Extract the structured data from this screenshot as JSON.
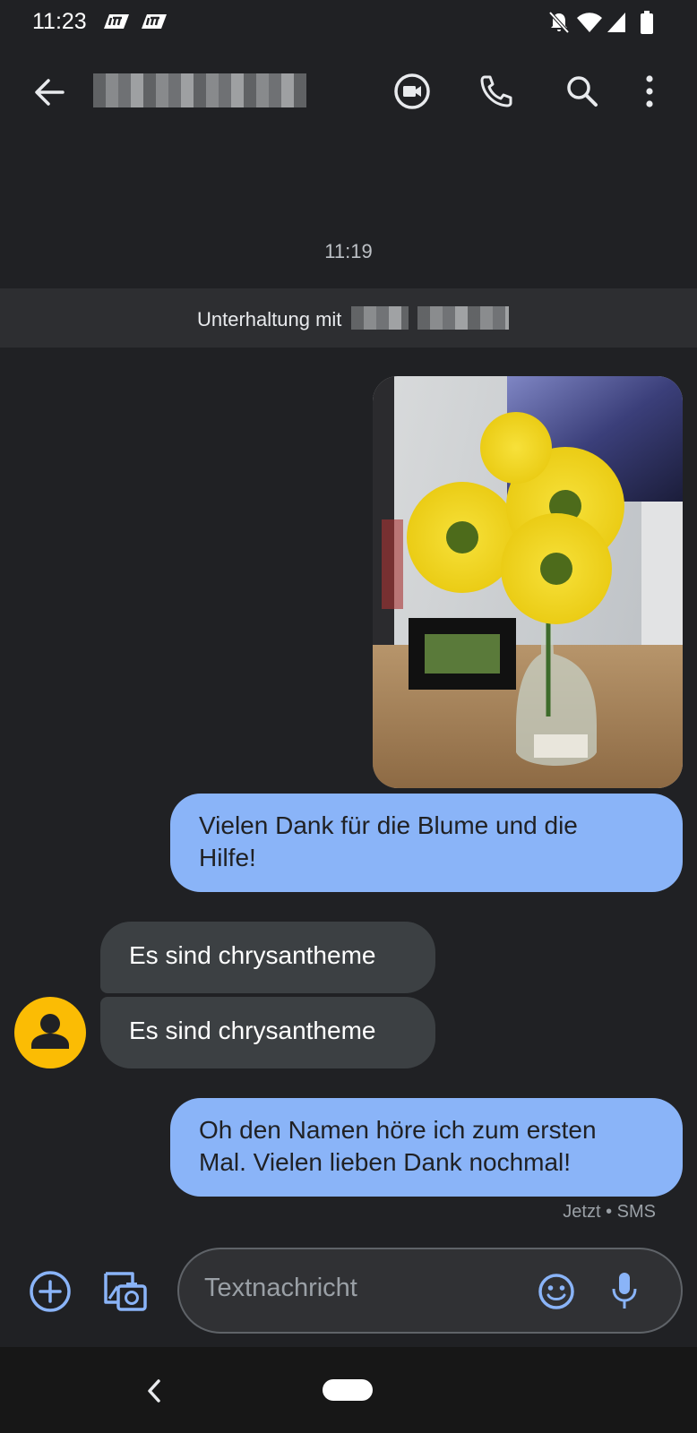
{
  "status_bar": {
    "time": "11:23"
  },
  "conversation": {
    "timestamp": "11:19",
    "banner_text": "Unterhaltung mit"
  },
  "messages": [
    {
      "type": "image",
      "direction": "outgoing"
    },
    {
      "type": "text",
      "direction": "outgoing",
      "lines": [
        "Vielen Dank für die Blume und die",
        "Hilfe!"
      ]
    },
    {
      "type": "text",
      "direction": "incoming",
      "text": "Es sind chrysantheme"
    },
    {
      "type": "text",
      "direction": "incoming",
      "text": "Es sind chrysantheme"
    },
    {
      "type": "text",
      "direction": "outgoing",
      "lines": [
        "Oh den Namen höre ich zum ersten",
        "Mal. Vielen lieben Dank nochmal!"
      ]
    }
  ],
  "last_message_meta": "Jetzt • SMS",
  "compose": {
    "placeholder": "Textnachricht"
  },
  "colors": {
    "background": "#202124",
    "outgoing_bubble": "#8ab4f8",
    "incoming_bubble": "#3c4043",
    "avatar": "#fbbc04"
  },
  "icons": {
    "back": "back-arrow-icon",
    "video": "video-call-icon",
    "phone": "phone-icon",
    "search": "search-icon",
    "more": "more-vert-icon",
    "add": "add-circle-icon",
    "gallery": "gallery-camera-icon",
    "emoji": "emoji-icon",
    "mic": "mic-icon"
  }
}
